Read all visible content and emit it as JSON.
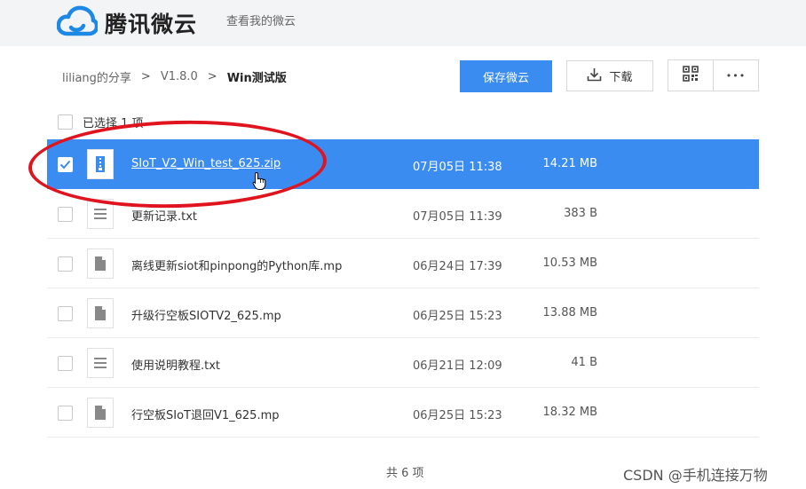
{
  "header": {
    "app_name": "腾讯微云",
    "nav_link": "查看我的微云",
    "logo_icon": "cloud-icon",
    "brand_color": "#3b8cf0"
  },
  "breadcrumb": {
    "items": [
      "liliang的分享",
      "V1.8.0"
    ],
    "current": "Win测试版",
    "separator": ">"
  },
  "toolbar": {
    "save_label": "保存微云",
    "download_label": "下载",
    "download_icon": "download-icon",
    "qr_icon": "qrcode-icon",
    "more_label": "•••"
  },
  "selection": {
    "label": "已选择 1 项"
  },
  "files": [
    {
      "name": "SIoT_V2_Win_test_625.zip",
      "date": "07月05日 11:38",
      "size": "14.21 MB",
      "icon": "zip-file-icon",
      "selected": true
    },
    {
      "name": "更新记录.txt",
      "date": "07月05日 11:39",
      "size": "383 B",
      "icon": "text-file-icon",
      "selected": false
    },
    {
      "name": "离线更新siot和pinpong的Python库.mp",
      "date": "06月24日 17:39",
      "size": "10.53 MB",
      "icon": "generic-file-icon",
      "selected": false
    },
    {
      "name": "升级行空板SIOTV2_625.mp",
      "date": "06月25日 15:23",
      "size": "13.88 MB",
      "icon": "generic-file-icon",
      "selected": false
    },
    {
      "name": "使用说明教程.txt",
      "date": "06月21日 12:09",
      "size": "41 B",
      "icon": "text-file-icon",
      "selected": false
    },
    {
      "name": "行空板SIoT退回V1_625.mp",
      "date": "06月25日 15:23",
      "size": "18.32 MB",
      "icon": "generic-file-icon",
      "selected": false
    }
  ],
  "footer": {
    "count_label": "共 6 项"
  },
  "watermark": "CSDN @手机连接万物",
  "annotation_color": "#e0141e"
}
